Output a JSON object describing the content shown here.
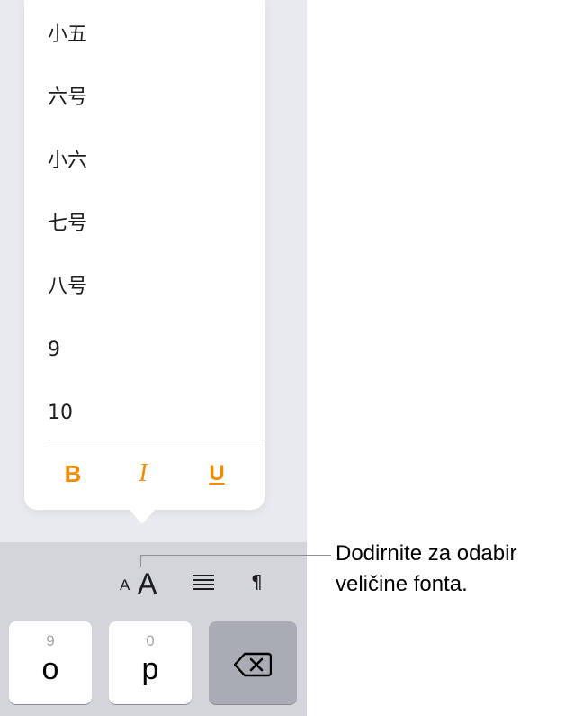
{
  "font_size_menu": {
    "items": [
      "小五",
      "六号",
      "小六",
      "七号",
      "八号",
      "9",
      "10"
    ]
  },
  "text_style": {
    "bold_label": "B",
    "italic_label": "I",
    "underline_label": "U"
  },
  "toolbar": {
    "font_size_small_a": "A",
    "font_size_big_a": "A",
    "paragraph_label": "¶"
  },
  "keyboard": {
    "key_o": {
      "char": "o",
      "hint": "9"
    },
    "key_p": {
      "char": "p",
      "hint": "0"
    },
    "delete_icon": "delete-backward-icon"
  },
  "callout": {
    "line1": "Dodirnite za odabir",
    "line2": "veličine fonta."
  },
  "colors": {
    "accent": "#f08c00",
    "keyboard_bg": "#d3d5db",
    "panel_bg": "#e9eaee"
  }
}
